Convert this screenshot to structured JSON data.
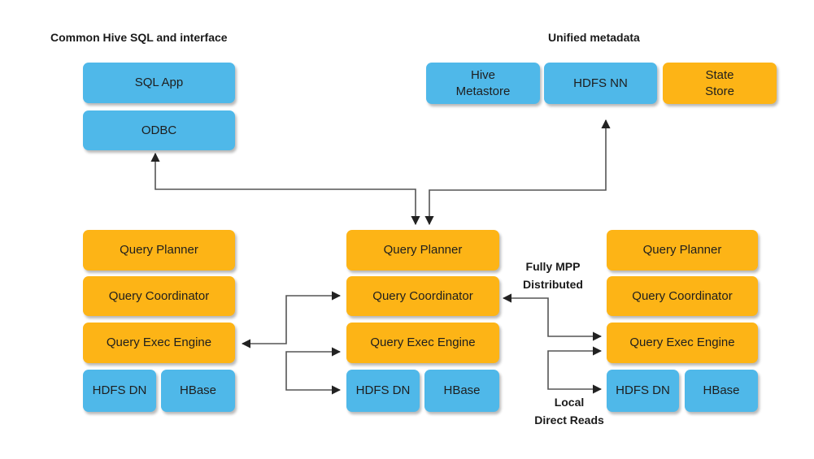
{
  "headings": {
    "left": "Common Hive SQL and interface",
    "right": "Unified metadata"
  },
  "client": {
    "sql_app": "SQL App",
    "odbc": "ODBC"
  },
  "metadata": {
    "hive_metastore": "Hive Metastore",
    "hdfs_nn": "HDFS NN",
    "state_store": "State Store"
  },
  "nodes": [
    {
      "planner": "Query Planner",
      "coordinator": "Query Coordinator",
      "exec": "Query Exec Engine",
      "hdfs_dn": "HDFS DN",
      "hbase": "HBase"
    },
    {
      "planner": "Query Planner",
      "coordinator": "Query Coordinator",
      "exec": "Query Exec Engine",
      "hdfs_dn": "HDFS DN",
      "hbase": "HBase"
    },
    {
      "planner": "Query Planner",
      "coordinator": "Query Coordinator",
      "exec": "Query Exec Engine",
      "hdfs_dn": "HDFS DN",
      "hbase": "HBase"
    }
  ],
  "annotations": {
    "mpp_line1": "Fully MPP",
    "mpp_line2": "Distributed",
    "local_line1": "Local",
    "local_line2": "Direct Reads"
  },
  "colors": {
    "service_blue": "#4FB8E9",
    "impala_orange": "#FDB416"
  }
}
